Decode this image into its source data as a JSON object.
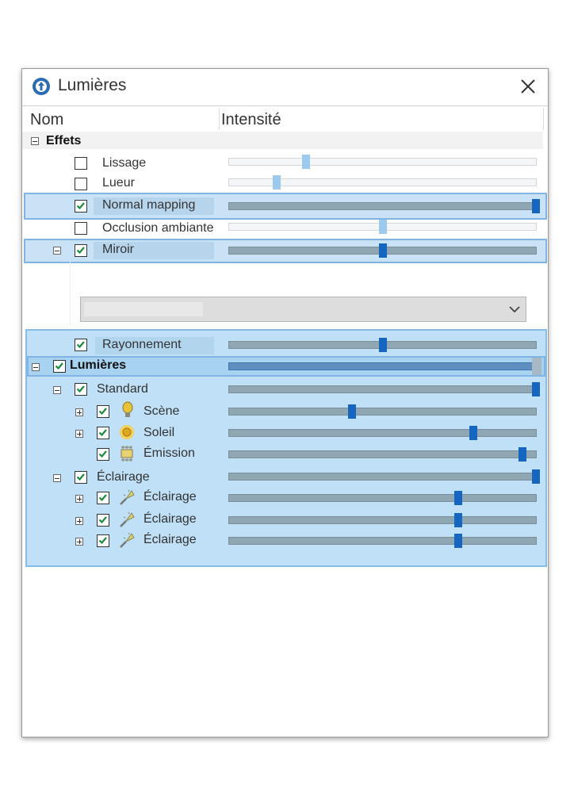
{
  "window": {
    "title": "Lumières"
  },
  "columns": {
    "name": "Nom",
    "intensity": "Intensité"
  },
  "groups": {
    "effets": "Effets"
  },
  "rows": [
    {
      "label": "Lissage",
      "checked": false,
      "value": 0.25
    },
    {
      "label": "Lueur",
      "checked": false,
      "value": 0.155
    },
    {
      "label": "Normal mapping",
      "checked": true,
      "value": 1.0
    },
    {
      "label": "Occlusion ambiante",
      "checked": false,
      "value": 0.5
    },
    {
      "label": "Miroir",
      "checked": true,
      "value": 0.5
    },
    {
      "label": "Rayonnement",
      "checked": true,
      "value": 0.5
    },
    {
      "label": "Lumières",
      "checked": true,
      "value": 1.0
    },
    {
      "label": "Standard",
      "checked": true,
      "value": 1.0
    },
    {
      "label": "Scène",
      "checked": true,
      "value": 0.4
    },
    {
      "label": "Soleil",
      "checked": true,
      "value": 0.8
    },
    {
      "label": "Émission",
      "checked": true,
      "value": 0.96
    },
    {
      "label": "Éclairage",
      "checked": true,
      "value": 1.0
    },
    {
      "label": "Éclairage",
      "checked": true,
      "value": 0.75
    },
    {
      "label": "Éclairage",
      "checked": true,
      "value": 0.75
    },
    {
      "label": "Éclairage",
      "checked": true,
      "value": 0.75
    }
  ],
  "colors": {
    "accent": "#1466c0",
    "selection": "#bfe0f7",
    "track_on": "#8fa6b3"
  },
  "icons": [
    "app-icon",
    "close-icon",
    "bulb-icon",
    "sun-icon",
    "emission-icon",
    "spotlight-icon",
    "chevron-down-icon"
  ]
}
